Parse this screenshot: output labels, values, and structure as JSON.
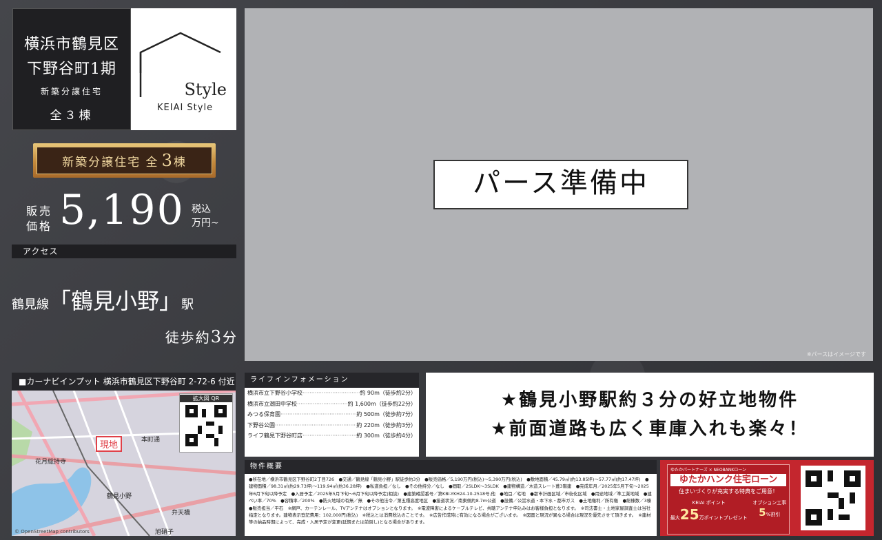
{
  "title": {
    "line1": "横浜市鶴見区",
    "line2": "下野谷町1期",
    "line3": "新築分譲住宅",
    "line4": "全３棟"
  },
  "logo": {
    "word": "Style",
    "sub": "KEIAI  Style"
  },
  "banner": {
    "prefix": "新築分譲住宅 全",
    "count": "3",
    "suffix": "棟"
  },
  "price": {
    "label": "販売価格",
    "value": "5,190",
    "unit_line1": "税込",
    "unit_line2": "万円~"
  },
  "access": {
    "header": "アクセス",
    "line": "鶴見線",
    "station": "「鶴見小野」",
    "station_suffix": "駅",
    "walk_prefix": "徒歩約",
    "walk_minutes": "3",
    "walk_unit": "分"
  },
  "image": {
    "placeholder": "パース準備中",
    "note": "※パースはイメージです"
  },
  "map": {
    "header": "■カーナビインプット 横浜市鶴見区下野谷町 2-72-6 付近",
    "qr_label": "拡大図 QR",
    "site_label": "現地",
    "labels": [
      "花月総持寺",
      "鶴見小野",
      "弁天橋",
      "本町通",
      "旭硝子"
    ],
    "credit": "© OpenStreetMap contributors"
  },
  "lifeinfo": {
    "title": "ライフインフォメーション",
    "items": [
      {
        "name": "横浜市立下野谷小学校",
        "distance": "約 90m（徒歩約2分）"
      },
      {
        "name": "横浜市立潮田中学校",
        "distance": "約 1,600m（徒歩約22分）"
      },
      {
        "name": "みつる保育園",
        "distance": "約 500m（徒歩約7分）"
      },
      {
        "name": "下野谷公園",
        "distance": "約 220m（徒歩約3分）"
      },
      {
        "name": "ライフ鶴見下野谷町店",
        "distance": "約 300m（徒歩約4分）"
      }
    ]
  },
  "highlights": [
    "★鶴見小野駅約３分の好立地物件",
    "★前面道路も広く車庫入れも楽々！"
  ],
  "overview": {
    "title": "物件概要",
    "text": "●所在地／横浜市鶴見区下野谷町2丁目726　●交通／鶴見線「鶴見小野」駅徒歩約3分　●販売価格／5,190万円(税込)～5,390万円(税込)　●敷地面積／45.79㎡(約13.85坪)～57.77㎡(約17.47坪)　●建物面積／98.31㎡(約29.73坪)～119.94㎡(約36.28坪)　●私道負担／なし　●その他持分／なし　●間取／2SLDK～3SLDK　●建物構造／木造スレート葺3階建　●完成年月／2025年5月下旬～2025年6月下旬以降予定　●入居予定／2025年5月下旬～6月下旬以降予定(相談)　●建築確認番号／第KBI-YKH24-10-2518号,他　●地目／宅地　●都市計画区域／市街化区域　●用途地域／準工業地域　●建ぺい率／70%　●容積率／200%　●防火地域の有無／無　●その他法令／第五種高度地区　●接道状況／南東側約8.7m公道　●設備／公営水道・本下水・都市ガス　●土地権利／所有権　●総棟数／3棟　●販売担当／平石　※網戸、カーテンレール、TVアンテナはオプションとなります。　※電波障害によるケーブルテレビ、共聴アンテナ申込みはお客様負担となります。　※司法書士・土地家屋調査士は当社指定となります。建物表示登記費用：102,000円(税込)　※税込とは消費税込のことです。　※広告作成時に有効になる場合がございます。　※図面と現況が異なる場合は現況を優先させて頂きます。　※建材等の納品時期によって、完成・入居予定が変更(延期または前倒し)となる場合があります。"
  },
  "loan": {
    "partners": "ゆたかパートナーズ × NEOBANKローン",
    "title": "ゆたかハンク住宅ローン",
    "subtitle": "住まいづくりが充実する特典をご用意！",
    "point_label": "KEIAI ポイント",
    "point_prefix": "最大",
    "point_value": "25",
    "point_unit": "万ポイントプレゼント",
    "option_label": "オプション工事",
    "option_value": "5",
    "option_unit": "%割引"
  },
  "colors": {
    "background": "#3d3e42",
    "gold": "#c48a3c",
    "loan_red": "#c4262e",
    "site_pin": "#e04048"
  }
}
